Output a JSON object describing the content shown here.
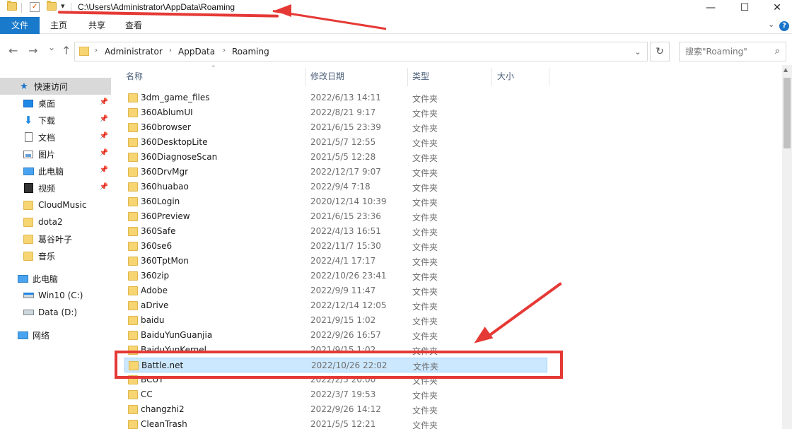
{
  "window": {
    "path": "C:\\Users\\Administrator\\AppData\\Roaming",
    "minimize": "—",
    "maximize": "☐",
    "close": "✕"
  },
  "ribbon": {
    "tabs": [
      "文件",
      "主页",
      "共享",
      "查看"
    ],
    "expand_icon": "chevron-down-icon",
    "help_label": "?"
  },
  "nav": {
    "back": "←",
    "forward": "→",
    "recent": "⌄",
    "up": "↑"
  },
  "address": {
    "segments": [
      "Administrator",
      "AppData",
      "Roaming"
    ],
    "search_placeholder": "搜索\"Roaming\""
  },
  "sidebar": {
    "quick_access": "快速访问",
    "items": [
      {
        "label": "桌面",
        "icon": "desktop-icon",
        "pinned": true
      },
      {
        "label": "下载",
        "icon": "download-icon",
        "pinned": true
      },
      {
        "label": "文档",
        "icon": "document-icon",
        "pinned": true
      },
      {
        "label": "图片",
        "icon": "picture-icon",
        "pinned": true
      },
      {
        "label": "此电脑",
        "icon": "computer-icon",
        "pinned": true
      },
      {
        "label": "视频",
        "icon": "video-icon",
        "pinned": true
      },
      {
        "label": "CloudMusic",
        "icon": "folder-icon",
        "pinned": false
      },
      {
        "label": "dota2",
        "icon": "folder-icon",
        "pinned": false
      },
      {
        "label": "葛谷叶子",
        "icon": "folder-icon",
        "pinned": false
      },
      {
        "label": "音乐",
        "icon": "folder-icon",
        "pinned": false
      }
    ],
    "this_pc": "此电脑",
    "drives": [
      {
        "label": "Win10 (C:)",
        "icon": "windows-drive-icon"
      },
      {
        "label": "Data (D:)",
        "icon": "drive-icon"
      }
    ],
    "network": "网络"
  },
  "columns": {
    "name": "名称",
    "modified": "修改日期",
    "type": "类型",
    "size": "大小"
  },
  "files": [
    {
      "name": "3dm_game_files",
      "date": "2022/6/13 14:11",
      "type": "文件夹"
    },
    {
      "name": "360AblumUI",
      "date": "2022/8/21 9:17",
      "type": "文件夹"
    },
    {
      "name": "360browser",
      "date": "2021/6/15 23:39",
      "type": "文件夹"
    },
    {
      "name": "360DesktopLite",
      "date": "2021/5/7 12:55",
      "type": "文件夹"
    },
    {
      "name": "360DiagnoseScan",
      "date": "2021/5/5 12:28",
      "type": "文件夹"
    },
    {
      "name": "360DrvMgr",
      "date": "2022/12/17 9:07",
      "type": "文件夹"
    },
    {
      "name": "360huabao",
      "date": "2022/9/4 7:18",
      "type": "文件夹"
    },
    {
      "name": "360Login",
      "date": "2020/12/14 10:39",
      "type": "文件夹"
    },
    {
      "name": "360Preview",
      "date": "2021/6/15 23:36",
      "type": "文件夹"
    },
    {
      "name": "360Safe",
      "date": "2022/4/13 16:51",
      "type": "文件夹"
    },
    {
      "name": "360se6",
      "date": "2022/11/7 15:30",
      "type": "文件夹"
    },
    {
      "name": "360TptMon",
      "date": "2022/4/1 17:17",
      "type": "文件夹"
    },
    {
      "name": "360zip",
      "date": "2022/10/26 23:41",
      "type": "文件夹"
    },
    {
      "name": "Adobe",
      "date": "2022/9/9 11:47",
      "type": "文件夹"
    },
    {
      "name": "aDrive",
      "date": "2022/12/14 12:05",
      "type": "文件夹"
    },
    {
      "name": "baidu",
      "date": "2021/9/15 1:02",
      "type": "文件夹"
    },
    {
      "name": "BaiduYunGuanjia",
      "date": "2022/9/26 16:57",
      "type": "文件夹"
    },
    {
      "name": "BaiduYunKernel",
      "date": "2021/9/15 1:02",
      "type": "文件夹"
    },
    {
      "name": "Battle.net",
      "date": "2022/10/26 22:02",
      "type": "文件夹",
      "selected": true
    },
    {
      "name": "BCUT",
      "date": "2022/2/5 20:00",
      "type": "文件夹"
    },
    {
      "name": "CC",
      "date": "2022/3/7 19:53",
      "type": "文件夹"
    },
    {
      "name": "changzhi2",
      "date": "2022/9/26 14:12",
      "type": "文件夹"
    },
    {
      "name": "CleanTrash",
      "date": "2021/5/5 12:21",
      "type": "文件夹"
    }
  ],
  "colors": {
    "accent": "#1979ca",
    "selection": "#cce8ff",
    "annotation": "#e53935"
  }
}
